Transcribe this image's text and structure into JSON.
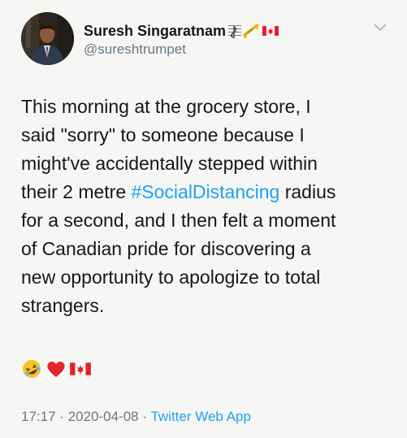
{
  "user": {
    "display_name": "Suresh Singaratnam",
    "handle": "@sureshtrumpet",
    "name_emoji": [
      "music-score-icon",
      "trumpet-icon",
      "canada-flag-icon"
    ]
  },
  "tweet": {
    "lines": [
      [
        "This morning at the grocery store, I"
      ],
      [
        "said \"sorry\" to someone because I"
      ],
      [
        "might've accidentally stepped within"
      ],
      [
        "their 2 metre ",
        "#SocialDistancing",
        " radius"
      ],
      [
        "for a second, and I then felt a moment"
      ],
      [
        "of Canadian pride for discovering a"
      ],
      [
        "new opportunity to apologize to total"
      ],
      [
        "strangers."
      ]
    ],
    "reaction_emoji": [
      "rofl-icon",
      "red-heart-icon",
      "canada-flag-icon"
    ]
  },
  "meta": {
    "time": "17:17",
    "sep1": " · ",
    "date": "2020-04-08",
    "sep2": " · ",
    "source": "Twitter Web App"
  },
  "colors": {
    "background": "#f6f7f4",
    "text": "#14171a",
    "secondary": "#657786",
    "link": "#1da1f2",
    "flag_red": "#e0232b"
  }
}
